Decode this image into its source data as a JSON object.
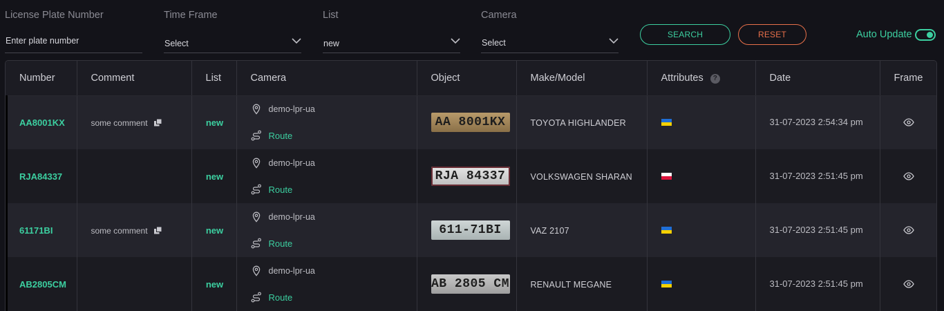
{
  "filters": {
    "plate": {
      "label": "License Plate Number",
      "placeholder": "Enter plate number"
    },
    "time_frame": {
      "label": "Time Frame",
      "value": "Select"
    },
    "list": {
      "label": "List",
      "value": "new"
    },
    "camera": {
      "label": "Camera",
      "value": "Select"
    },
    "search_label": "SEARCH",
    "reset_label": "RESET",
    "auto_update_label": "Auto Update",
    "auto_update_on": true
  },
  "colors": {
    "accent": "#3ccfa0",
    "reset": "#e8704a",
    "background": "#131319"
  },
  "table": {
    "headers": {
      "number": "Number",
      "comment": "Comment",
      "list": "List",
      "camera": "Camera",
      "object": "Object",
      "make_model": "Make/Model",
      "attributes": "Attributes",
      "date": "Date",
      "frame": "Frame"
    },
    "rows": [
      {
        "number": "AA8001KX",
        "comment": "some comment",
        "list": "new",
        "camera": "demo-lpr-ua",
        "route": "Route",
        "plate_text": "AA 8001KX",
        "make": "TOYOTA HIGHLANDER",
        "flag": "ua-flag",
        "date": "31-07-2023 2:54:34 pm"
      },
      {
        "number": "RJA84337",
        "comment": "",
        "list": "new",
        "camera": "demo-lpr-ua",
        "route": "Route",
        "plate_text": "RJA 84337",
        "make": "VOLKSWAGEN SHARAN",
        "flag": "pl-flag",
        "date": "31-07-2023 2:51:45 pm"
      },
      {
        "number": "61171BI",
        "comment": "some comment",
        "list": "new",
        "camera": "demo-lpr-ua",
        "route": "Route",
        "plate_text": "611-71BI",
        "make": "VAZ 2107",
        "flag": "ua-flag",
        "date": "31-07-2023 2:51:45 pm"
      },
      {
        "number": "AB2805CM",
        "comment": "",
        "list": "new",
        "camera": "demo-lpr-ua",
        "route": "Route",
        "plate_text": "AB 2805 CM",
        "make": "RENAULT MEGANE",
        "flag": "ua-flag",
        "date": "31-07-2023 2:51:45 pm"
      }
    ]
  }
}
